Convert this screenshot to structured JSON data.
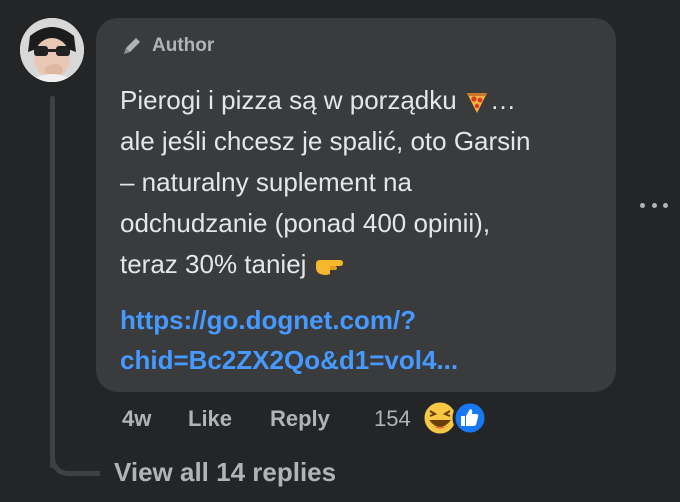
{
  "comment": {
    "author_badge": "Author",
    "text_lines": [
      "Pierogi i pizza są w porządku",
      "ale jeśli chcesz je spalić, oto Garsin",
      "– naturalny suplement na",
      "odchudzanie (ponad 400 opinii),",
      "teraz 30% taniej"
    ],
    "ellipsis": "…",
    "link_lines": [
      "https://go.dognet.com/?",
      "chid=Bc2ZX2Qo&d1=vol4..."
    ]
  },
  "actions": {
    "time": "4w",
    "like_label": "Like",
    "reply_label": "Reply",
    "reaction_count": "154"
  },
  "replies": {
    "view_all_label": "View all 14 replies"
  },
  "colors": {
    "background": "#242526",
    "bubble": "#3a3b3c",
    "text": "#e4e6eb",
    "muted": "#b0b3b8",
    "link": "#4599ff",
    "like_blue": "#1877f2"
  },
  "icons": {
    "badge": "pencil-icon",
    "inline_1": "pizza-emoji",
    "inline_2": "pointing-hand-emoji",
    "more": "more-dots-icon",
    "reaction_1": "haha-reaction-icon",
    "reaction_2": "like-reaction-icon"
  }
}
